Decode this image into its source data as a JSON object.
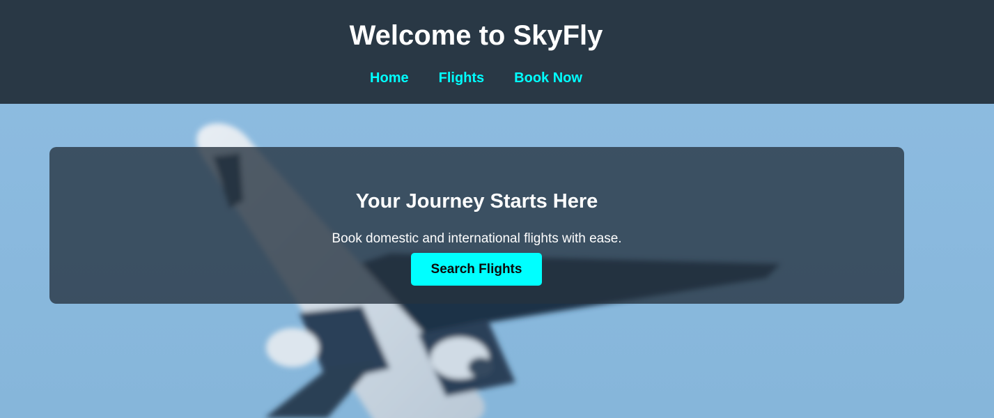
{
  "header": {
    "title": "Welcome to SkyFly",
    "nav": [
      {
        "label": "Home"
      },
      {
        "label": "Flights"
      },
      {
        "label": "Book Now"
      }
    ]
  },
  "hero": {
    "title": "Your Journey Starts Here",
    "subtitle": "Book domestic and international flights with ease.",
    "button_label": "Search Flights",
    "background_image": "airplane-photo"
  },
  "colors": {
    "header_bg": "#293845",
    "accent": "#00ffff",
    "sky": "#8bbadf",
    "card_bg": "#25323f"
  }
}
